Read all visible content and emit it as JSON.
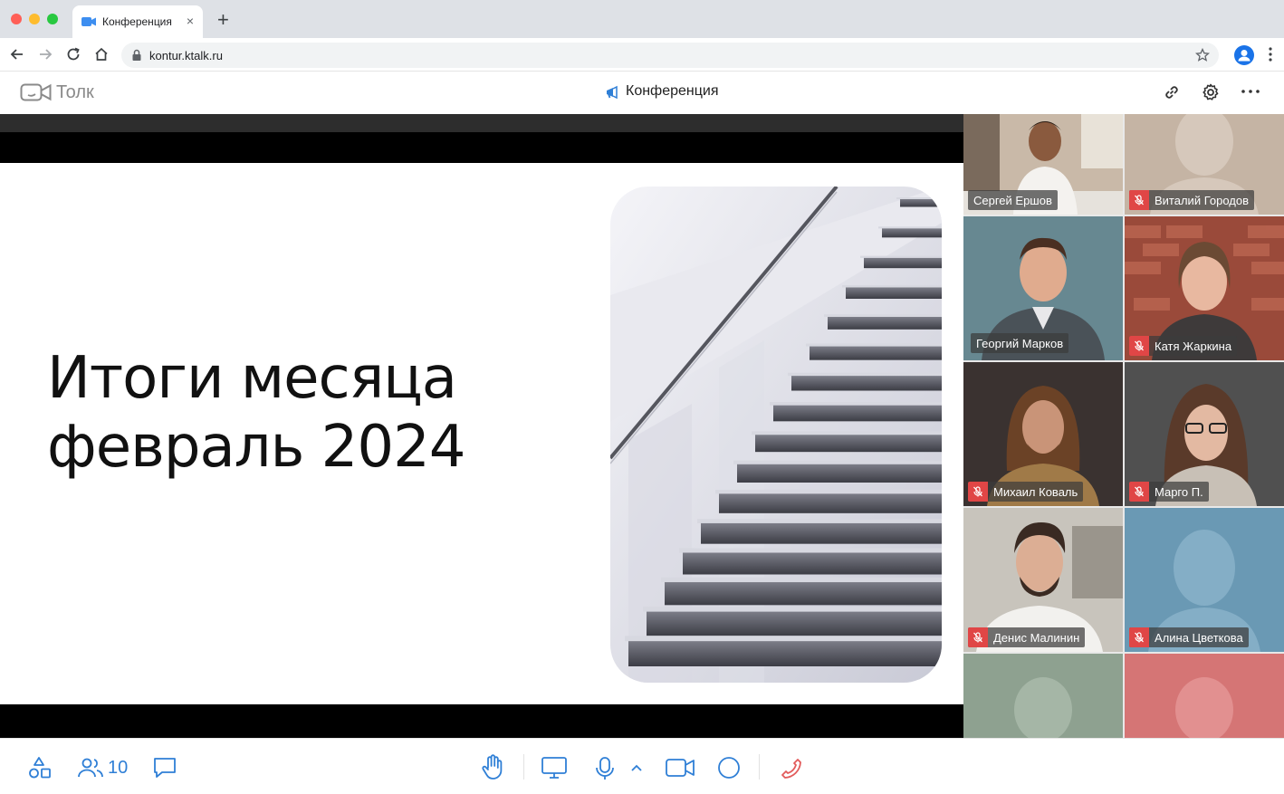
{
  "browser": {
    "tab_title": "Конференция",
    "tab_close": "×",
    "new_tab": "+",
    "url": "kontur.ktalk.ru"
  },
  "app": {
    "logo_text": "Толк",
    "conference_title": "Конференция"
  },
  "slide": {
    "title_line1": "Итоги месяца",
    "title_line2": "февраль 2024"
  },
  "participants": [
    {
      "name": "Сергей Ершов",
      "muted": false,
      "video": true
    },
    {
      "name": "Виталий Городов",
      "muted": true,
      "video": false
    },
    {
      "name": "Георгий Марков",
      "muted": false,
      "video": true,
      "speaking": true
    },
    {
      "name": "Катя Жаркина",
      "muted": true,
      "video": true
    },
    {
      "name": "Михаил Коваль",
      "muted": true,
      "video": true
    },
    {
      "name": "Марго П.",
      "muted": true,
      "video": true
    },
    {
      "name": "Денис Малинин",
      "muted": true,
      "video": true
    },
    {
      "name": "Алина Цветкова",
      "muted": true,
      "video": false
    },
    {
      "name": "",
      "muted": false,
      "video": false
    },
    {
      "name": "",
      "muted": false,
      "video": false
    }
  ],
  "controls": {
    "participant_count": "10"
  },
  "colors": {
    "accent": "#2f7fd6",
    "mute_red": "#e04646",
    "end_call": "#e25b5b",
    "active_speaker": "#2f8cf0"
  }
}
